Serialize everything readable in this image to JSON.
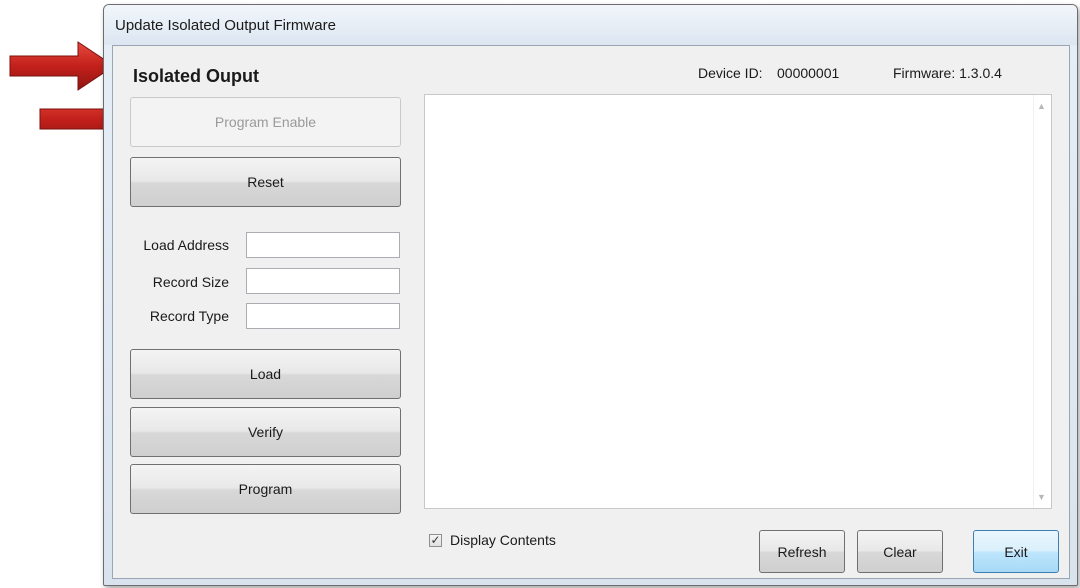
{
  "window": {
    "title": "Update Isolated Output Firmware"
  },
  "header": {
    "section_title": "Isolated Ouput",
    "device_id_label": "Device ID:",
    "device_id_value": "00000001",
    "firmware_label": "Firmware: 1.3.0.4"
  },
  "buttons": {
    "program_enable": "Program Enable",
    "reset": "Reset",
    "load": "Load",
    "verify": "Verify",
    "program": "Program",
    "refresh": "Refresh",
    "clear": "Clear",
    "exit": "Exit"
  },
  "fields": {
    "load_address": {
      "label": "Load Address",
      "value": ""
    },
    "record_size": {
      "label": "Record Size",
      "value": ""
    },
    "record_type": {
      "label": "Record Type",
      "value": ""
    }
  },
  "contents": {
    "text": ""
  },
  "display_contents": {
    "label": "Display Contents",
    "checked": true
  },
  "annotations": {
    "arrow_color": "#c0201c"
  }
}
